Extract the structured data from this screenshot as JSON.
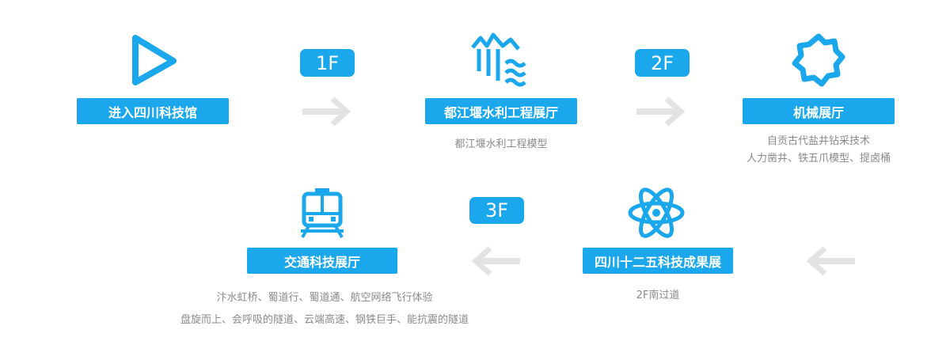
{
  "colors": {
    "accent": "#1aa7ec",
    "arrow": "#e6e6e6",
    "desc_text": "#8a8a8a"
  },
  "steps": [
    {
      "icon": "play-icon",
      "label": "进入四川科技馆",
      "desc": []
    },
    {
      "icon": "dam-water-icon",
      "label": "都江堰水利工程展厅",
      "desc": [
        "都江堰水利工程模型"
      ]
    },
    {
      "icon": "gear-icon",
      "label": "机械展厅",
      "desc": [
        "自贡古代盐井钻采技术",
        "人力凿井、铁五爪模型、提卤桶"
      ]
    },
    {
      "icon": "atom-icon",
      "label": "四川十二五科技成果展",
      "desc": [
        "2F南过道"
      ]
    },
    {
      "icon": "train-icon",
      "label": "交通科技展厅",
      "desc": [
        "汴水虹桥、蜀道行、蜀道通、航空网络飞行体验",
        "盘旋而上、会呼吸的隧道、云端高速、钢铁巨手、能抗震的隧道"
      ]
    }
  ],
  "floors": [
    "1F",
    "2F",
    "3F"
  ]
}
